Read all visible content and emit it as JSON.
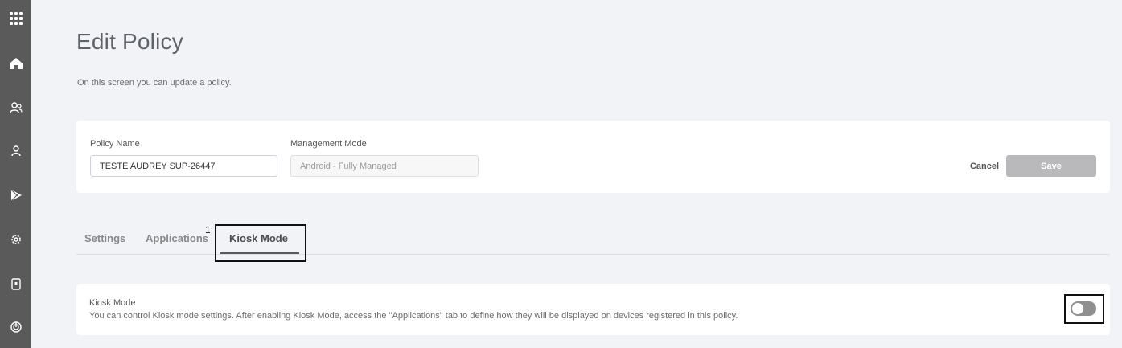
{
  "sidebar": {
    "icons": [
      {
        "name": "apps-grid-icon"
      },
      {
        "name": "home-icon"
      },
      {
        "name": "users-icon"
      },
      {
        "name": "user-icon"
      },
      {
        "name": "play-store-icon"
      },
      {
        "name": "settings-gear-icon"
      },
      {
        "name": "device-icon"
      },
      {
        "name": "power-icon"
      }
    ]
  },
  "page": {
    "title": "Edit Policy",
    "subtitle": "On this screen you can update a policy."
  },
  "form": {
    "policy_name_label": "Policy Name",
    "policy_name_value": "TESTE AUDREY SUP-26447",
    "management_mode_label": "Management Mode",
    "management_mode_value": "Android - Fully Managed",
    "cancel_label": "Cancel",
    "save_label": "Save"
  },
  "tabs": {
    "settings": "Settings",
    "applications": "Applications",
    "kiosk_mode": "Kiosk Mode",
    "annotation_number": "1"
  },
  "kiosk": {
    "title": "Kiosk Mode",
    "description": "You can control Kiosk mode settings. After enabling Kiosk Mode, access the \"Applications\" tab to define how they will be displayed on devices registered in this policy.",
    "enabled": false
  },
  "colors": {
    "sidebar_bg": "#5a5a5a",
    "page_bg": "#f2f3f7",
    "save_disabled": "#b9b9bb"
  }
}
